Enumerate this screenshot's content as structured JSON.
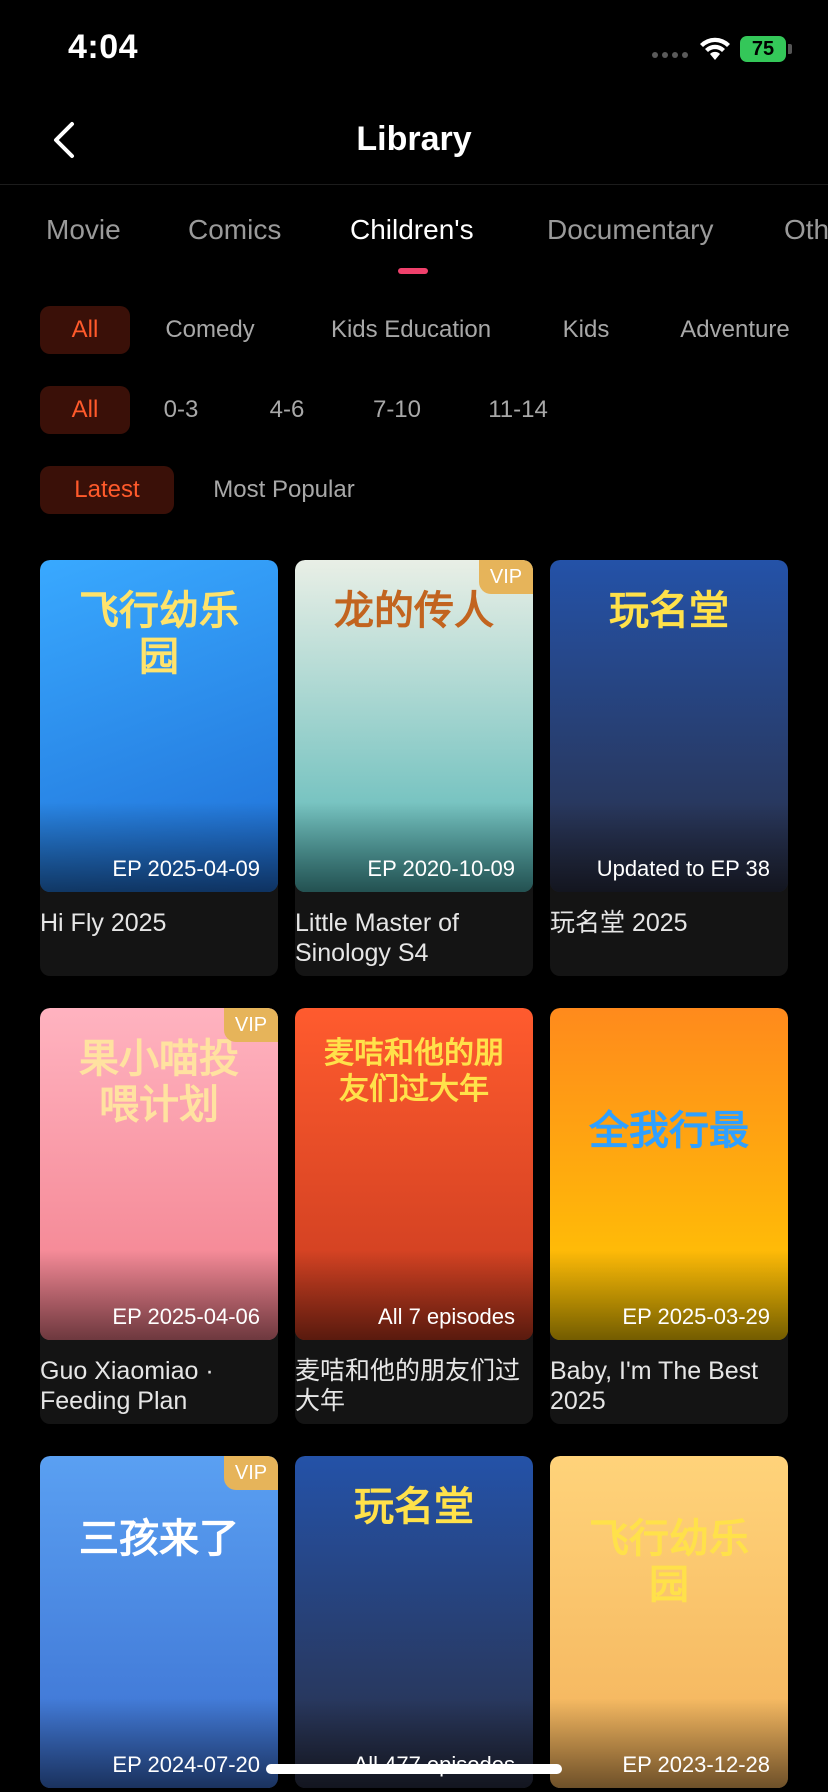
{
  "status_bar": {
    "time": "4:04",
    "battery": "75"
  },
  "header": {
    "title": "Library"
  },
  "category_tabs": [
    {
      "label": "Movie",
      "active": false
    },
    {
      "label": "Comics",
      "active": false
    },
    {
      "label": "Children's",
      "active": true
    },
    {
      "label": "Documentary",
      "active": false
    },
    {
      "label": "Oth",
      "active": false
    }
  ],
  "genre_filters": [
    "All",
    "Comedy",
    "Kids Education",
    "Kids",
    "Adventure"
  ],
  "age_filters": [
    "All",
    "0-3",
    "4-6",
    "7-10",
    "11-14"
  ],
  "sort_filters": [
    "Latest",
    "Most Popular"
  ],
  "cards": [
    {
      "title": "Hi Fly 2025",
      "episode": "EP 2025-04-09",
      "vip": "",
      "art": "飞行幼乐园",
      "colors": [
        "#39a9ff",
        "#1f6fd6"
      ]
    },
    {
      "title": "Little Master of Sinology S4",
      "episode": "EP 2020-10-09",
      "vip": "VIP",
      "art": "龙的传人",
      "colors": [
        "#e9efe6",
        "#4fb4b4"
      ]
    },
    {
      "title": "玩名堂 2025",
      "episode": "Updated to EP 38",
      "vip": "",
      "art": "玩名堂",
      "colors": [
        "#2452a8",
        "#2a2f45"
      ]
    },
    {
      "title": "Guo Xiaomiao · Feeding Plan",
      "episode": "EP 2025-04-06",
      "vip": "VIP",
      "art": "果小喵投喂计划",
      "colors": [
        "#ffb3c0",
        "#f27d8a"
      ]
    },
    {
      "title": "麦咭和他的朋友们过大年",
      "episode": "All 7 episodes",
      "vip": "",
      "art": "麦咭和他的朋友们过大年",
      "colors": [
        "#ff5b2e",
        "#c63a1f"
      ]
    },
    {
      "title": "Baby, I'm The Best 2025",
      "episode": "EP 2025-03-29",
      "vip": "",
      "art": "全我行最",
      "colors": [
        "#ff8a1c",
        "#ffcc00"
      ]
    },
    {
      "title": "",
      "episode": "EP 2024-07-20",
      "vip": "VIP",
      "art": "三孩来了",
      "colors": [
        "#5aa0f2",
        "#3b6fd0"
      ]
    },
    {
      "title": "",
      "episode": "All 477 episodes",
      "vip": "",
      "art": "玩名堂",
      "colors": [
        "#2452a8",
        "#2a2f45"
      ]
    },
    {
      "title": "",
      "episode": "EP 2023-12-28",
      "vip": "",
      "art": "飞行幼乐园",
      "colors": [
        "#ffd37a",
        "#f3b15a"
      ]
    }
  ]
}
